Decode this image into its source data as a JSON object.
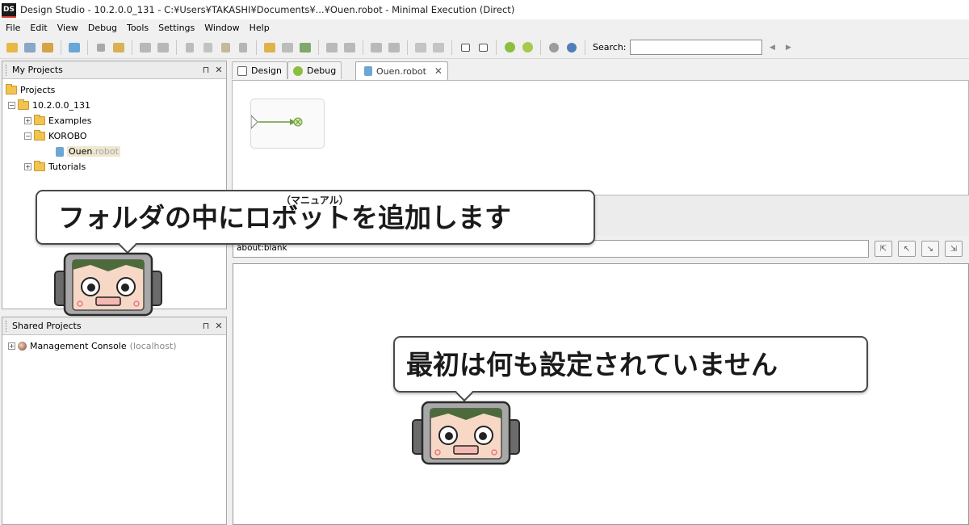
{
  "window": {
    "title": "Design Studio - 10.2.0.0_131 - C:¥Users¥TAKASHI¥Documents¥...¥Ouen.robot - Minimal Execution (Direct)",
    "logo": "DS"
  },
  "menu": [
    "File",
    "Edit",
    "View",
    "Debug",
    "Tools",
    "Settings",
    "Window",
    "Help"
  ],
  "toolbar": {
    "search_label": "Search:",
    "search_value": ""
  },
  "my_projects": {
    "title": "My Projects",
    "pin": "⊓",
    "close": "✕",
    "tree": {
      "root": "Projects",
      "project": "10.2.0.0_131",
      "folders": [
        "Examples",
        "KOROBO",
        "Tutorials"
      ],
      "robot_name": "Ouen",
      "robot_ext": ".robot"
    }
  },
  "shared_projects": {
    "title": "Shared Projects",
    "console_name": "Management Console",
    "console_host": "(localhost)"
  },
  "tabs": {
    "design": "Design",
    "debug": "Debug",
    "file": "Ouen.robot",
    "close": "✕"
  },
  "browser": {
    "url": "about:blank"
  },
  "callouts": {
    "top_text_before": "フォルダの中に",
    "top_ruby_word": "ロボット",
    "top_text_after": "を追加します",
    "top_ruby": "（マニュアル）",
    "bottom_text": "最初は何も設定されていません"
  },
  "colors": {
    "accent": "#6e9a3c",
    "folder": "#f2c34f",
    "robot": "#6ba7d6"
  }
}
